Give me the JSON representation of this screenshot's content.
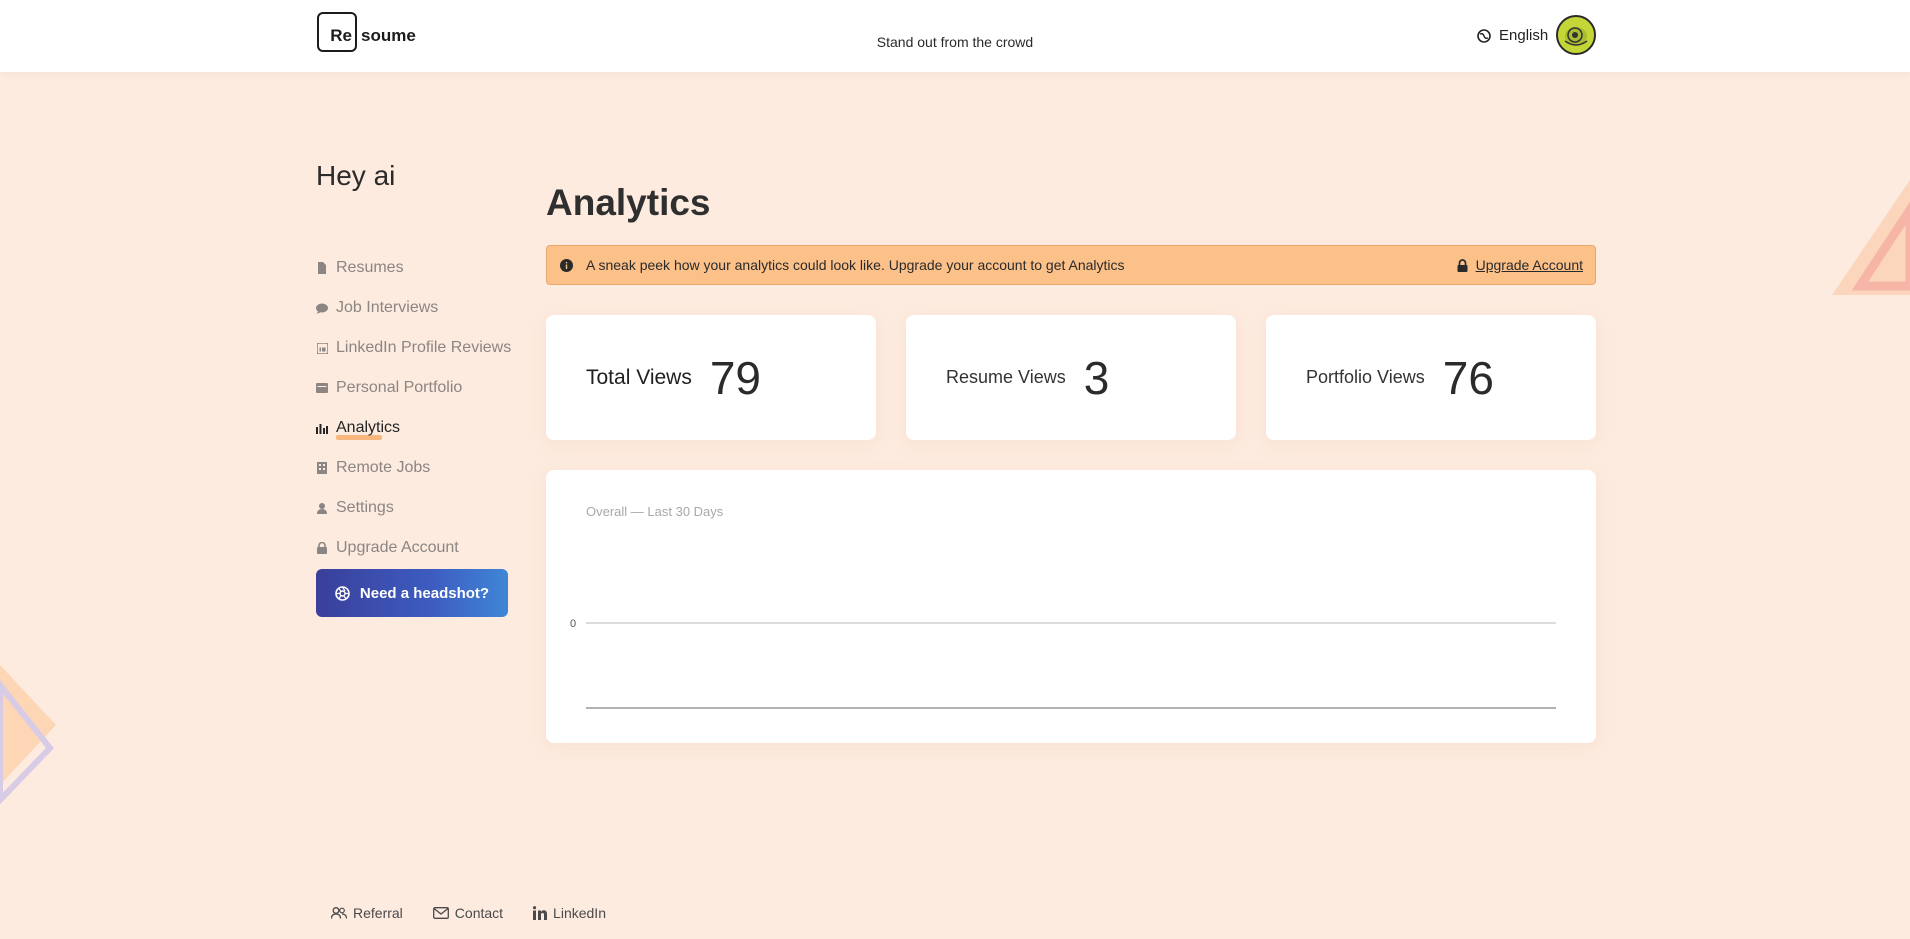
{
  "header": {
    "logo_box": "Re",
    "logo_rest": "soume",
    "tagline": "Stand out from the crowd",
    "language": "English"
  },
  "sidebar": {
    "greeting": "Hey ai",
    "items": [
      {
        "label": "Resumes",
        "icon": "document-icon"
      },
      {
        "label": "Job Interviews",
        "icon": "chat-bubble-icon"
      },
      {
        "label": "LinkedIn Profile Reviews",
        "icon": "linkedin-icon"
      },
      {
        "label": "Personal Portfolio",
        "icon": "portfolio-icon"
      },
      {
        "label": "Analytics",
        "icon": "bar-chart-icon",
        "active": true
      },
      {
        "label": "Remote Jobs",
        "icon": "building-icon"
      },
      {
        "label": "Settings",
        "icon": "user-icon"
      },
      {
        "label": "Upgrade Account",
        "icon": "lock-icon"
      }
    ],
    "headshot_button": "Need a headshot?"
  },
  "main": {
    "title": "Analytics",
    "alert_text": "A sneak peek how your analytics could look like. Upgrade your account to get Analytics",
    "alert_link": "Upgrade Account",
    "stats": [
      {
        "label": "Total Views",
        "value": "79"
      },
      {
        "label": "Resume Views",
        "value": "3"
      },
      {
        "label": "Portfolio Views",
        "value": "76"
      }
    ]
  },
  "chart_data": {
    "type": "line",
    "title": "Overall — Last 30 Days",
    "x": [],
    "series": [
      {
        "values": []
      }
    ],
    "yticks": [
      "0"
    ],
    "grid": true
  },
  "footer": {
    "links": [
      "Referral",
      "Contact",
      "LinkedIn"
    ]
  },
  "colors": {
    "background": "#fdebdf",
    "alert": "#fcc089",
    "accent_underline": "#f7b77e",
    "button_gradient_start": "#3a3f9a",
    "button_gradient_end": "#3f86d6"
  }
}
